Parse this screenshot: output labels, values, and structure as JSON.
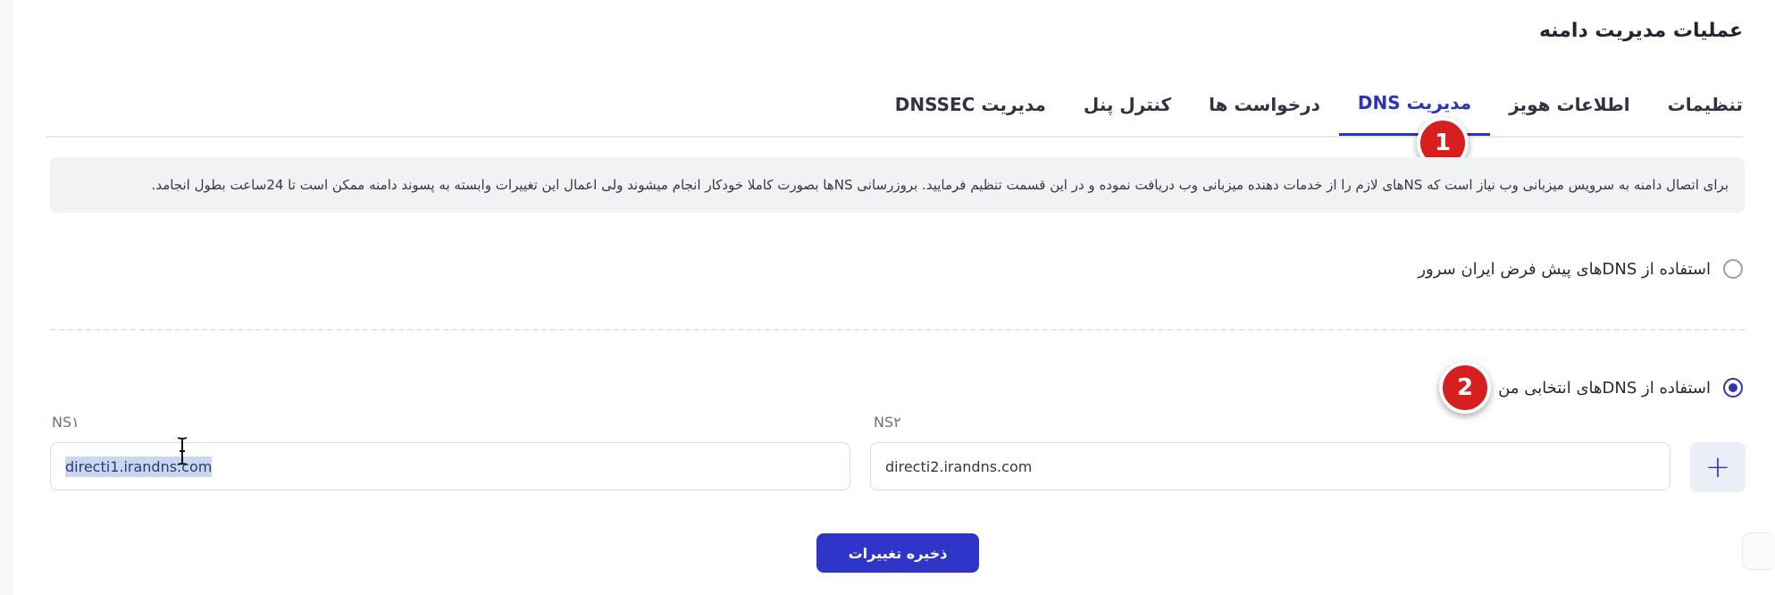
{
  "page": {
    "title": "عملیات مدیریت دامنه"
  },
  "tabs": [
    {
      "label": "تنظیمات"
    },
    {
      "label": "اطلاعات هویز"
    },
    {
      "label": "مدیریت DNS"
    },
    {
      "label": "درخواست ها"
    },
    {
      "label": "کنترل پنل"
    },
    {
      "label": "مدیریت DNSSEC"
    }
  ],
  "active_tab": "مدیریت DNS",
  "markers": {
    "one": "1",
    "two": "2"
  },
  "info": {
    "text": "برای اتصال دامنه به سرویس میزبانی وب نیاز است که NSهای لازم را از خدمات دهنده میزبانی وب دریافت نموده و در این قسمت تنظیم فرمایید. بروزرسانی NSها بصورت کاملا خودکار انجام میشوند ولی اعمال این تغییرات وابسته به پسوند دامنه ممکن است تا 24ساعت بطول انجامد."
  },
  "options": {
    "default_dns": {
      "label": "استفاده از DNSهای پیش فرض ایران سرور",
      "checked": false
    },
    "custom_dns": {
      "label": "استفاده از DNSهای انتخابی من",
      "checked": true
    }
  },
  "fields": {
    "ns1": {
      "label": "NS۱",
      "value": "directi1.irandns.com"
    },
    "ns2": {
      "label": "NS۲",
      "value": "directi2.irandns.com"
    }
  },
  "buttons": {
    "add_icon": "plus-icon",
    "save": "ذخیره تغییرات"
  },
  "colors": {
    "accent": "#2d35b5",
    "marker": "#d81f1f",
    "info_bg": "#f1f2f4"
  }
}
